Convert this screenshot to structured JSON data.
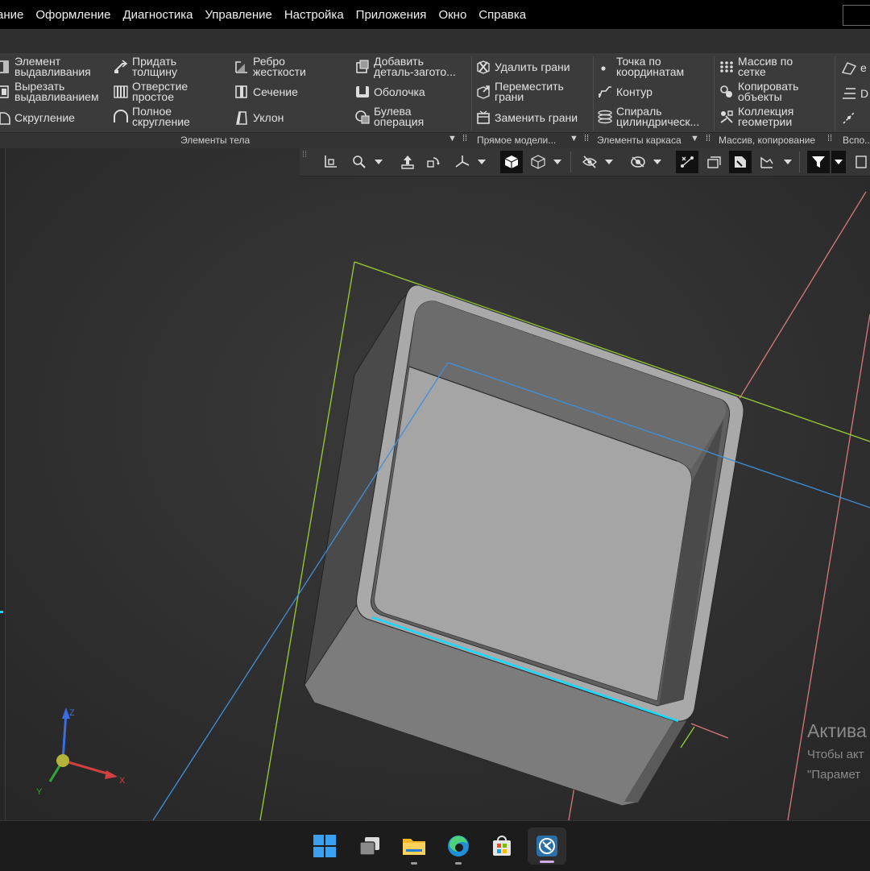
{
  "menu": [
    "ание",
    "Оформление",
    "Диагностика",
    "Управление",
    "Настройка",
    "Приложения",
    "Окно",
    "Справка"
  ],
  "ribbon": {
    "body_elements": {
      "group_label": "Элементы тела",
      "extrude": [
        "Элемент",
        "выдавливания"
      ],
      "cut_extrude": [
        "Вырезать",
        "выдавливанием"
      ],
      "fillet": "Скругление",
      "thicken": [
        "Придать",
        "толщину"
      ],
      "hole": [
        "Отверстие",
        "простое"
      ],
      "full_round": [
        "Полное",
        "скругление"
      ],
      "rib": [
        "Ребро",
        "жесткости"
      ],
      "section": "Сечение",
      "draft": "Уклон",
      "add_blank": [
        "Добавить",
        "деталь-загото..."
      ],
      "shell": "Оболочка",
      "boolean": [
        "Булева",
        "операция"
      ]
    },
    "direct_modeling": {
      "group_label": "Прямое модели...",
      "delete_faces": "Удалить грани",
      "move_faces": [
        "Переместить",
        "грани"
      ],
      "replace_faces": "Заменить грани"
    },
    "wireframe": {
      "group_label": "Элементы каркаса",
      "point_by_coords": [
        "Точка по",
        "координатам"
      ],
      "contour": "Контур",
      "spiral": [
        "Спираль",
        "цилиндрическ..."
      ]
    },
    "array": {
      "group_label": "Массив, копирование",
      "grid_array": [
        "Массив по",
        "сетке"
      ],
      "copy_objects": [
        "Копировать",
        "объекты"
      ],
      "geometry_collection": [
        "Коллекция",
        "геометрии"
      ]
    },
    "aux": {
      "group_label": "Вспо...",
      "item_top": "е",
      "item_mid": "D"
    }
  },
  "watermark": {
    "title": "Актива",
    "line1": "Чтобы акт",
    "line2": "\"Парамет"
  },
  "triad": {
    "z": "Z",
    "y": "Y",
    "x": "X"
  },
  "colors": {
    "green_plane": "#9acd32",
    "blue_plane": "#3f8fd8",
    "red_plane": "#d9787c",
    "selected_edge": "#18d8ff",
    "model_body": "#8e8e8e"
  }
}
